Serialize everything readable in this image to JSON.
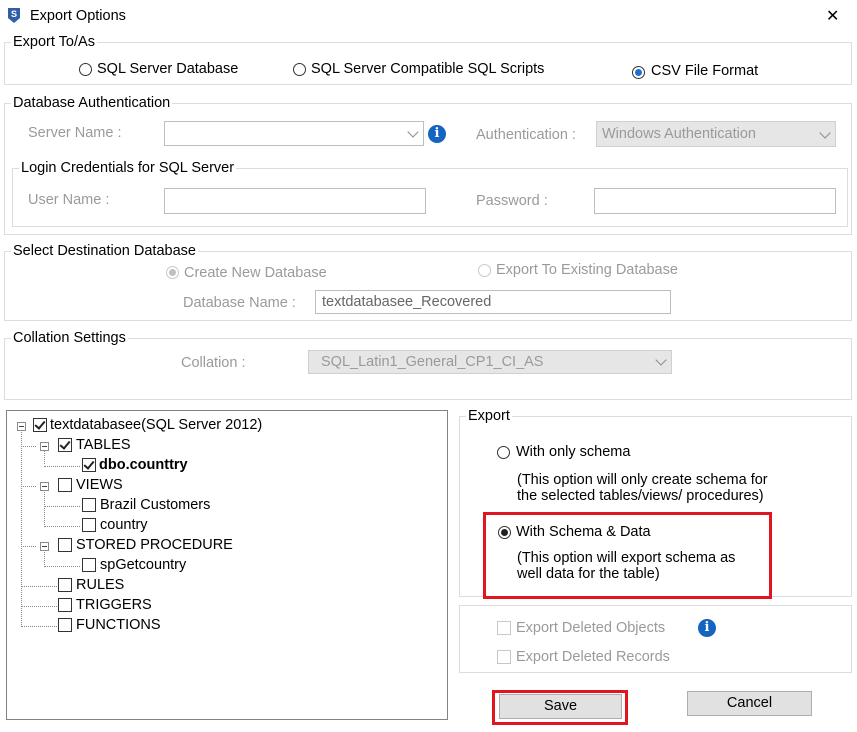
{
  "window": {
    "title": "Export Options",
    "icon": "app-logo-icon",
    "close_glyph": "✕"
  },
  "export_to": {
    "legend": "Export To/As",
    "options": [
      "SQL Server Database",
      "SQL Server Compatible SQL Scripts",
      "CSV File Format"
    ],
    "selected": "CSV File Format"
  },
  "db_auth": {
    "legend": "Database Authentication",
    "server_name_label": "Server Name :",
    "server_name_value": "",
    "authentication_label": "Authentication :",
    "authentication_value": "Windows Authentication"
  },
  "login": {
    "legend": "Login Credentials for SQL Server",
    "user_name_label": "User Name :",
    "user_name_value": "",
    "password_label": "Password :",
    "password_value": ""
  },
  "destination": {
    "legend": "Select Destination Database",
    "create_new": "Create New Database",
    "export_existing": "Export To Existing Database",
    "db_name_label": "Database Name :",
    "db_name_value": "textdatabasee_Recovered"
  },
  "collation": {
    "legend": "Collation Settings",
    "label": "Collation :",
    "value": "SQL_Latin1_General_CP1_CI_AS"
  },
  "tree": {
    "root": "textdatabasee(SQL Server 2012)",
    "tables": "TABLES",
    "table_item": "dbo.counttry",
    "views": "VIEWS",
    "view_items": [
      "Brazil Customers",
      "country"
    ],
    "stored_procedure": "STORED PROCEDURE",
    "sp_items": [
      "spGetcountry"
    ],
    "rules": "RULES",
    "triggers": "TRIGGERS",
    "functions": "FUNCTIONS"
  },
  "export": {
    "legend": "Export",
    "schema_only": "With only schema",
    "schema_only_desc_1": "(This option will only create schema for",
    "schema_only_desc_2": "the  selected tables/views/ procedures)",
    "schema_data": "With Schema & Data",
    "schema_data_desc_1": "(This option will export schema as",
    "schema_data_desc_2": "well data for the table)",
    "selected": "With Schema & Data"
  },
  "deleted": {
    "objects": "Export Deleted Objects",
    "records": "Export Deleted Records"
  },
  "buttons": {
    "save": "Save",
    "cancel": "Cancel"
  },
  "colors": {
    "highlight": "#e0151f",
    "info_icon": "#1565c0",
    "radio_selected": "#1e6fd0"
  }
}
